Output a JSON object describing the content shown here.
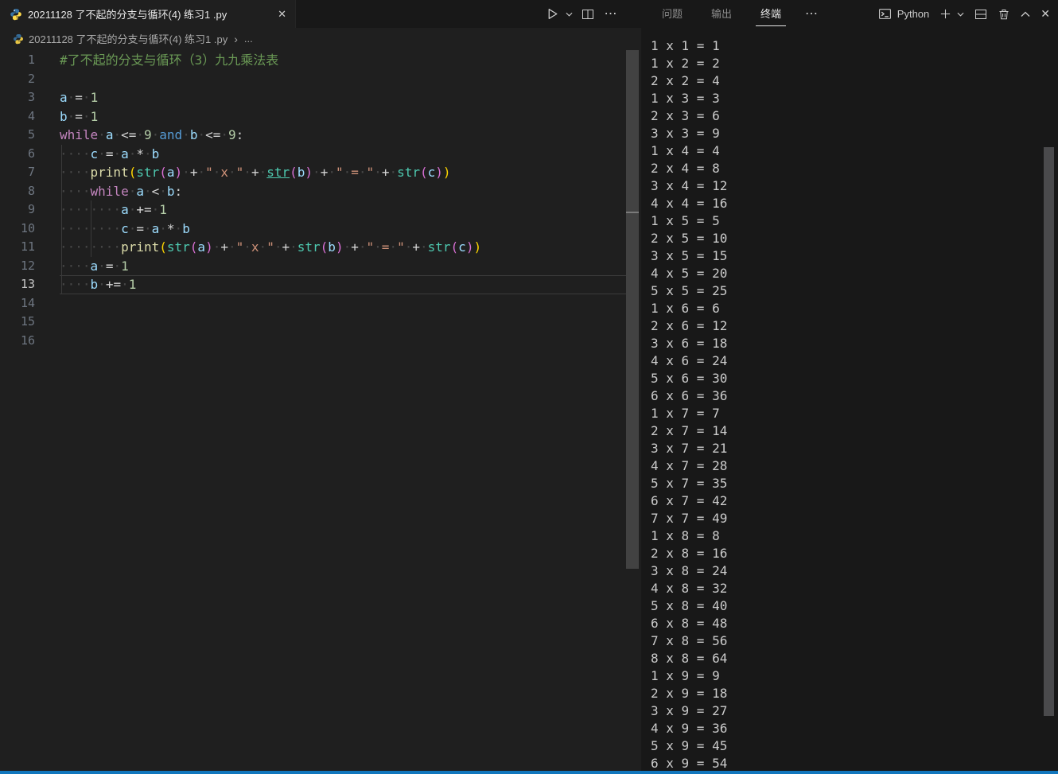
{
  "colors": {
    "accent_blue": "#1277bd",
    "editor_background": "#1f1f1f",
    "panel_background": "#181818",
    "comment_green": "#6a9955",
    "keyword_pink": "#c586c0",
    "keyword_blue": "#569cd6",
    "variable_blue": "#9cdcfe",
    "number_green": "#b5cea8",
    "function_yellow": "#dcdcaa",
    "type_teal": "#4ec9b0",
    "string_orange": "#ce9178"
  },
  "icons": {
    "close": "✕",
    "more": "⋯",
    "breadcrumb_chevron": "›"
  },
  "editor_tab": {
    "title": "20211128 了不起的分支与循环(4) 练习1 .py"
  },
  "breadcrumb": {
    "file": "20211128 了不起的分支与循环(4) 练习1 .py",
    "more": "..."
  },
  "editor": {
    "lines": [
      {
        "n": 1,
        "current": false,
        "tokens": [
          [
            "cm",
            "#了不起的分支与循环（3）九九乘法表"
          ]
        ]
      },
      {
        "n": 2,
        "current": false,
        "tokens": []
      },
      {
        "n": 3,
        "current": false,
        "tokens": [
          [
            "v",
            "a"
          ],
          [
            "ws",
            "·"
          ],
          [
            "op",
            "="
          ],
          [
            "ws",
            "·"
          ],
          [
            "n",
            "1"
          ]
        ]
      },
      {
        "n": 4,
        "current": false,
        "tokens": [
          [
            "v",
            "b"
          ],
          [
            "ws",
            "·"
          ],
          [
            "op",
            "="
          ],
          [
            "ws",
            "·"
          ],
          [
            "n",
            "1"
          ]
        ]
      },
      {
        "n": 5,
        "current": false,
        "tokens": [
          [
            "kw",
            "while"
          ],
          [
            "ws",
            "·"
          ],
          [
            "v",
            "a"
          ],
          [
            "ws",
            "·"
          ],
          [
            "op",
            "<="
          ],
          [
            "ws",
            "·"
          ],
          [
            "n",
            "9"
          ],
          [
            "ws",
            "·"
          ],
          [
            "kw2",
            "and"
          ],
          [
            "ws",
            "·"
          ],
          [
            "v",
            "b"
          ],
          [
            "ws",
            "·"
          ],
          [
            "op",
            "<="
          ],
          [
            "ws",
            "·"
          ],
          [
            "n",
            "9"
          ],
          [
            "op",
            ":"
          ]
        ]
      },
      {
        "n": 6,
        "current": false,
        "tokens": [
          [
            "ws",
            "····"
          ],
          [
            "v",
            "c"
          ],
          [
            "ws",
            "·"
          ],
          [
            "op",
            "="
          ],
          [
            "ws",
            "·"
          ],
          [
            "v",
            "a"
          ],
          [
            "ws",
            "·"
          ],
          [
            "op",
            "*"
          ],
          [
            "ws",
            "·"
          ],
          [
            "v",
            "b"
          ]
        ]
      },
      {
        "n": 7,
        "current": false,
        "tokens": [
          [
            "ws",
            "····"
          ],
          [
            "fn",
            "print"
          ],
          [
            "b1",
            "("
          ],
          [
            "ty",
            "str"
          ],
          [
            "b2",
            "("
          ],
          [
            "v",
            "a"
          ],
          [
            "b2",
            ")"
          ],
          [
            "ws",
            "·"
          ],
          [
            "op",
            "+"
          ],
          [
            "ws",
            "·"
          ],
          [
            "s",
            "\""
          ],
          [
            "ws",
            "·"
          ],
          [
            "s",
            "x"
          ],
          [
            "ws",
            "·"
          ],
          [
            "s",
            "\""
          ],
          [
            "ws",
            "·"
          ],
          [
            "op",
            "+"
          ],
          [
            "ws",
            "·"
          ],
          [
            "tyu",
            "str"
          ],
          [
            "b2",
            "("
          ],
          [
            "v",
            "b"
          ],
          [
            "b2",
            ")"
          ],
          [
            "ws",
            "·"
          ],
          [
            "op",
            "+"
          ],
          [
            "ws",
            "·"
          ],
          [
            "s",
            "\""
          ],
          [
            "ws",
            "·"
          ],
          [
            "s",
            "="
          ],
          [
            "ws",
            "·"
          ],
          [
            "s",
            "\""
          ],
          [
            "ws",
            "·"
          ],
          [
            "op",
            "+"
          ],
          [
            "ws",
            "·"
          ],
          [
            "ty",
            "str"
          ],
          [
            "b2",
            "("
          ],
          [
            "v",
            "c"
          ],
          [
            "b2",
            ")"
          ],
          [
            "b1",
            ")"
          ]
        ]
      },
      {
        "n": 8,
        "current": false,
        "tokens": [
          [
            "ws",
            "····"
          ],
          [
            "kw",
            "while"
          ],
          [
            "ws",
            "·"
          ],
          [
            "v",
            "a"
          ],
          [
            "ws",
            "·"
          ],
          [
            "op",
            "<"
          ],
          [
            "ws",
            "·"
          ],
          [
            "v",
            "b"
          ],
          [
            "op",
            ":"
          ]
        ]
      },
      {
        "n": 9,
        "current": false,
        "tokens": [
          [
            "ws",
            "········"
          ],
          [
            "v",
            "a"
          ],
          [
            "ws",
            "·"
          ],
          [
            "op",
            "+="
          ],
          [
            "ws",
            "·"
          ],
          [
            "n",
            "1"
          ]
        ]
      },
      {
        "n": 10,
        "current": false,
        "tokens": [
          [
            "ws",
            "········"
          ],
          [
            "v",
            "c"
          ],
          [
            "ws",
            "·"
          ],
          [
            "op",
            "="
          ],
          [
            "ws",
            "·"
          ],
          [
            "v",
            "a"
          ],
          [
            "ws",
            "·"
          ],
          [
            "op",
            "*"
          ],
          [
            "ws",
            "·"
          ],
          [
            "v",
            "b"
          ]
        ]
      },
      {
        "n": 11,
        "current": false,
        "tokens": [
          [
            "ws",
            "········"
          ],
          [
            "fn",
            "print"
          ],
          [
            "b1",
            "("
          ],
          [
            "ty",
            "str"
          ],
          [
            "b2",
            "("
          ],
          [
            "v",
            "a"
          ],
          [
            "b2",
            ")"
          ],
          [
            "ws",
            "·"
          ],
          [
            "op",
            "+"
          ],
          [
            "ws",
            "·"
          ],
          [
            "s",
            "\""
          ],
          [
            "ws",
            "·"
          ],
          [
            "s",
            "x"
          ],
          [
            "ws",
            "·"
          ],
          [
            "s",
            "\""
          ],
          [
            "ws",
            "·"
          ],
          [
            "op",
            "+"
          ],
          [
            "ws",
            "·"
          ],
          [
            "ty",
            "str"
          ],
          [
            "b2",
            "("
          ],
          [
            "v",
            "b"
          ],
          [
            "b2",
            ")"
          ],
          [
            "ws",
            "·"
          ],
          [
            "op",
            "+"
          ],
          [
            "ws",
            "·"
          ],
          [
            "s",
            "\""
          ],
          [
            "ws",
            "·"
          ],
          [
            "s",
            "="
          ],
          [
            "ws",
            "·"
          ],
          [
            "s",
            "\""
          ],
          [
            "ws",
            "·"
          ],
          [
            "op",
            "+"
          ],
          [
            "ws",
            "·"
          ],
          [
            "ty",
            "str"
          ],
          [
            "b2",
            "("
          ],
          [
            "v",
            "c"
          ],
          [
            "b2",
            ")"
          ],
          [
            "b1",
            ")"
          ]
        ]
      },
      {
        "n": 12,
        "current": false,
        "tokens": [
          [
            "ws",
            "····"
          ],
          [
            "v",
            "a"
          ],
          [
            "ws",
            "·"
          ],
          [
            "op",
            "="
          ],
          [
            "ws",
            "·"
          ],
          [
            "n",
            "1"
          ]
        ]
      },
      {
        "n": 13,
        "current": true,
        "tokens": [
          [
            "ws",
            "····"
          ],
          [
            "v",
            "b"
          ],
          [
            "ws",
            "·"
          ],
          [
            "op",
            "+="
          ],
          [
            "ws",
            "·"
          ],
          [
            "n",
            "1"
          ]
        ]
      },
      {
        "n": 14,
        "current": false,
        "tokens": []
      },
      {
        "n": 15,
        "current": false,
        "tokens": []
      },
      {
        "n": 16,
        "current": false,
        "tokens": []
      }
    ]
  },
  "panel": {
    "tabs": [
      {
        "id": "problems",
        "label": "问题",
        "active": false
      },
      {
        "id": "output",
        "label": "输出",
        "active": false
      },
      {
        "id": "terminal",
        "label": "终端",
        "active": true
      }
    ],
    "terminal": {
      "name": "Python",
      "output": [
        "1 x 1 = 1",
        "1 x 2 = 2",
        "2 x 2 = 4",
        "1 x 3 = 3",
        "2 x 3 = 6",
        "3 x 3 = 9",
        "1 x 4 = 4",
        "2 x 4 = 8",
        "3 x 4 = 12",
        "4 x 4 = 16",
        "1 x 5 = 5",
        "2 x 5 = 10",
        "3 x 5 = 15",
        "4 x 5 = 20",
        "5 x 5 = 25",
        "1 x 6 = 6",
        "2 x 6 = 12",
        "3 x 6 = 18",
        "4 x 6 = 24",
        "5 x 6 = 30",
        "6 x 6 = 36",
        "1 x 7 = 7",
        "2 x 7 = 14",
        "3 x 7 = 21",
        "4 x 7 = 28",
        "5 x 7 = 35",
        "6 x 7 = 42",
        "7 x 7 = 49",
        "1 x 8 = 8",
        "2 x 8 = 16",
        "3 x 8 = 24",
        "4 x 8 = 32",
        "5 x 8 = 40",
        "6 x 8 = 48",
        "7 x 8 = 56",
        "8 x 8 = 64",
        "1 x 9 = 9",
        "2 x 9 = 18",
        "3 x 9 = 27",
        "4 x 9 = 36",
        "5 x 9 = 45",
        "6 x 9 = 54"
      ]
    }
  }
}
